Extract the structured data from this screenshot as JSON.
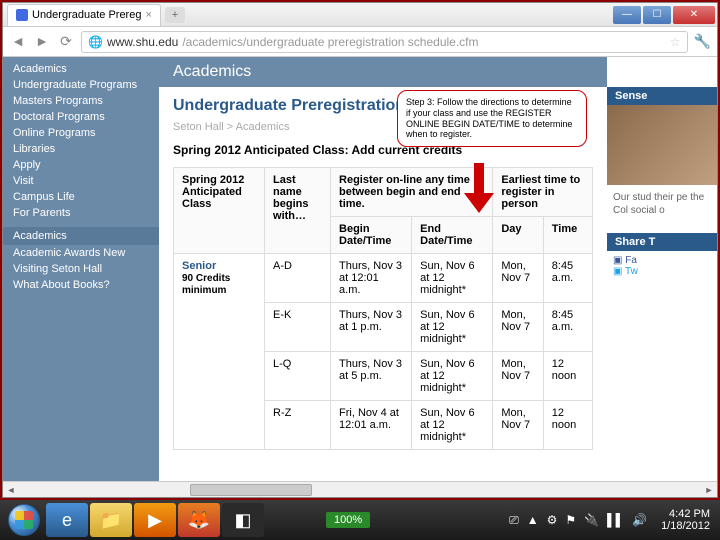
{
  "browser": {
    "tab_title": "Undergraduate Prereg",
    "url_domain": "www.shu.edu",
    "url_path": "/academics/undergraduate preregistration schedule.cfm"
  },
  "leftnav": {
    "items1": [
      "Academics",
      "Undergraduate Programs",
      "Masters Programs",
      "Doctoral Programs",
      "Online Programs",
      "Libraries",
      "Apply",
      "Visit",
      "Campus Life",
      "For Parents"
    ],
    "section": "Academics",
    "items2": [
      "Academic Awards New",
      "Visiting Seton Hall",
      "What About Books?"
    ]
  },
  "page": {
    "banner": "Academics",
    "title": "Undergraduate Preregistration Schedule",
    "breadcrumb": "Seton Hall > Academics",
    "subtitle": "Spring 2012 Anticipated Class: Add current credits"
  },
  "callout": "Step 3: Follow the directions to determine if your class and use the REGISTER ONLINE BEGIN DATE/TIME to determine when to register.",
  "table": {
    "headers": {
      "h1": "Spring 2012 Anticipated Class",
      "h2": "Last name begins with…",
      "h3": "Register on-line any time between begin and end time.",
      "h4": "Earliest time to register in person",
      "sub_begin": "Begin Date/Time",
      "sub_end": "End Date/Time",
      "sub_day": "Day",
      "sub_time": "Time"
    },
    "rows": [
      {
        "class": "Senior",
        "credits": "90 Credits minimum",
        "name": "A-D",
        "begin": "Thurs, Nov 3 at 12:01 a.m.",
        "end": "Sun, Nov 6 at 12 midnight*",
        "day": "Mon, Nov 7",
        "time": "8:45 a.m."
      },
      {
        "class": "",
        "credits": "",
        "name": "E-K",
        "begin": "Thurs, Nov 3 at 1 p.m.",
        "end": "Sun, Nov 6 at 12 midnight*",
        "day": "Mon, Nov 7",
        "time": "8:45 a.m."
      },
      {
        "class": "",
        "credits": "",
        "name": "L-Q",
        "begin": "Thurs, Nov 3 at 5 p.m.",
        "end": "Sun, Nov 6 at 12 midnight*",
        "day": "Mon, Nov 7",
        "time": "12 noon"
      },
      {
        "class": "",
        "credits": "",
        "name": "R-Z",
        "begin": "Fri, Nov 4 at 12:01 a.m.",
        "end": "Sun, Nov 6 at 12 midnight*",
        "day": "Mon, Nov 7",
        "time": "12 noon"
      }
    ]
  },
  "sidebar": {
    "box1": "Sense",
    "text": "Our stud their pe the Col social o",
    "share": "Share T",
    "fb": "Fa",
    "tw": "Tw"
  },
  "taskbar": {
    "zoom": "100%",
    "time": "4:42 PM",
    "date": "1/18/2012"
  }
}
